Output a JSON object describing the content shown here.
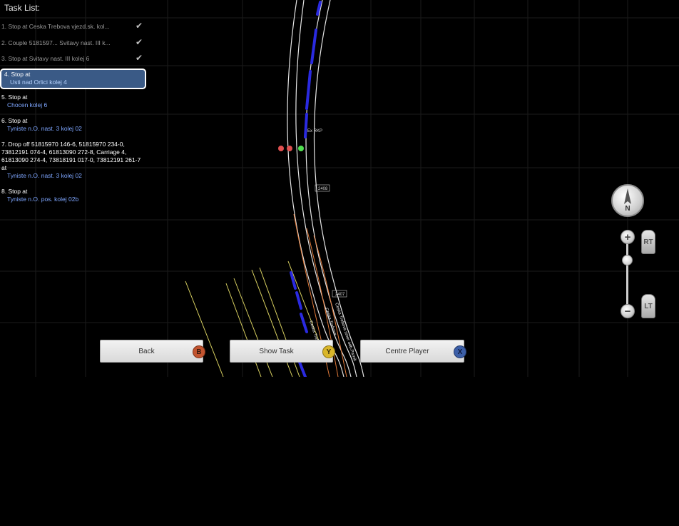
{
  "task_list": {
    "title": "Task List:",
    "tasks": [
      {
        "text": "1. Stop at  Ceska Trebova vjezd.sk. kol...",
        "status": "done"
      },
      {
        "text": "2. Couple 5181597... Svitavy nast. III k...",
        "status": "done"
      },
      {
        "text": "3. Stop at  Svitavy nast. III kolej 6",
        "status": "done"
      },
      {
        "head": "4. Stop at",
        "location": "Usti nad Orlici kolej 4",
        "status": "active"
      },
      {
        "head": "5. Stop at",
        "location": "Chocen kolej 6",
        "status": "pending"
      },
      {
        "head": "6. Stop at",
        "location": "Tyniste n.O. nast. 3 kolej 02",
        "status": "pending"
      },
      {
        "head": "7. Drop off 51815970 146-6, 51815970 234-0, 73812191 074-4, 61813090 272-8, Carriage 4, 61813090 274-4, 73818191 017-0, 73812191 261-7 at",
        "location": "Tyniste n.O. nast. 3 kolej 02",
        "status": "pending"
      },
      {
        "head": "8. Stop at",
        "location": "Tyniste n.O. pos. kolej 02b",
        "status": "pending"
      }
    ]
  },
  "buttons": {
    "back": {
      "label": "Back",
      "key": "B",
      "color": "#c2542f"
    },
    "show_task": {
      "label": "Show Task",
      "key": "Y",
      "color": "#d9b62a"
    },
    "centre_player": {
      "label": "Centre Player",
      "key": "X",
      "color": "#3c5fa8"
    }
  },
  "map": {
    "markers": [
      "2408",
      "2407",
      "Ex RKP"
    ],
    "track_labels": [
      "Ceska Trebova smer odb.Parnik",
      "Ceska Trebova",
      "Ceska Trebova"
    ],
    "signal_colors": [
      "#e05050",
      "#e05050",
      "#4fe04f"
    ],
    "train_color": "#2a2ae0",
    "track_color": "#e6e6e6",
    "alt_track_color": "#e07a3a",
    "yard_track_color": "#d8d060"
  },
  "compass": {
    "label": "N"
  },
  "zoom": {
    "in": "+",
    "out": "−",
    "rt": "RT",
    "lt": "LT"
  }
}
